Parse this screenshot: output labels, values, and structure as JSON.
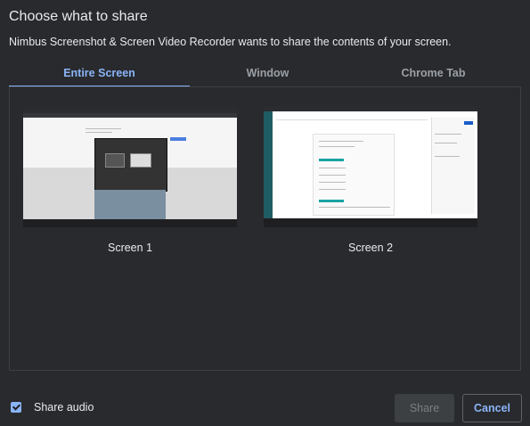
{
  "dialog": {
    "title": "Choose what to share",
    "subtitle": "Nimbus Screenshot & Screen Video Recorder wants to share the contents of your screen."
  },
  "tabs": [
    {
      "label": "Entire Screen",
      "active": true
    },
    {
      "label": "Window",
      "active": false
    },
    {
      "label": "Chrome Tab",
      "active": false
    }
  ],
  "screens": [
    {
      "label": "Screen 1"
    },
    {
      "label": "Screen 2"
    }
  ],
  "footer": {
    "share_audio_label": "Share audio",
    "share_audio_checked": true,
    "share_label": "Share",
    "cancel_label": "Cancel"
  },
  "colors": {
    "background": "#292a2d",
    "accent": "#8ab4f8",
    "disabled_button": "#3c4043"
  }
}
